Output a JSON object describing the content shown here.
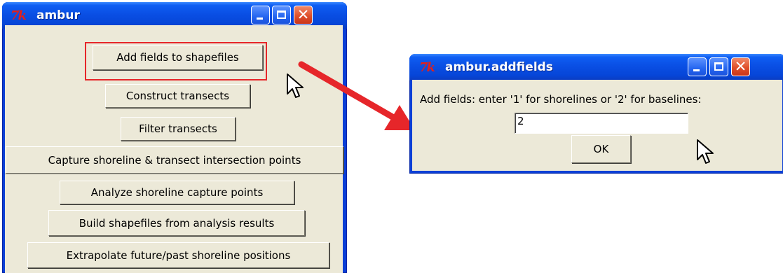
{
  "main_window": {
    "title": "ambur",
    "logo": "7k",
    "buttons": [
      "Add fields to shapefiles",
      "Construct transects",
      "Filter transects",
      "Capture shoreline & transect intersection points",
      "Analyze shoreline capture points",
      "Build shapefiles from analysis results",
      "Extrapolate future/past shoreline positions"
    ]
  },
  "dialog_window": {
    "title": "ambur.addfields",
    "logo": "7k",
    "prompt": "Add fields: enter '1' for shorelines or '2' for baselines:",
    "entry_value": "2",
    "ok_label": "OK"
  },
  "icons": [
    "tk-logo-icon",
    "minimize-icon",
    "maximize-icon",
    "close-icon",
    "mouse-cursor-icon",
    "red-arrow-icon"
  ],
  "colors": {
    "highlight": "#e6262a",
    "titlebar": "#0a4fe4",
    "client": "#ece9d8"
  }
}
